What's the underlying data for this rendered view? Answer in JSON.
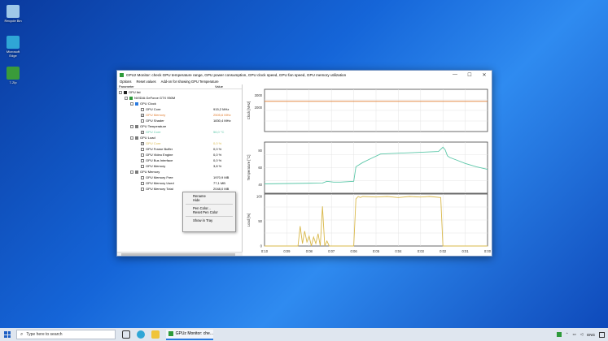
{
  "desktop": {
    "icons": [
      {
        "label": "Recycle Bin",
        "color": "#9ec8e8"
      },
      {
        "label": "Microsoft Edge",
        "color": "#2fa6d6"
      },
      {
        "label": "7-Zip",
        "color": "#3a9b3a"
      }
    ]
  },
  "window": {
    "title": "GPUz Monitor: check GPU temperature range, GPU power consumption, GPU clock speed, GPU fan speed, GPU memory utilization",
    "minimize": "—",
    "maximize": "☐",
    "close": "✕",
    "menu": [
      "Options",
      "Reset values",
      "Add-on for showing GPU Temperature"
    ]
  },
  "tree": {
    "col_parameter": "Parameter",
    "col_value": "Value",
    "rows": [
      {
        "label": "GPU list",
        "value": "",
        "level": 0,
        "exp": "-",
        "checked": false,
        "cb": false,
        "color": "#000",
        "icon": "#222"
      },
      {
        "label": "NVIDIA GeForce GTX 950M",
        "value": "",
        "level": 1,
        "exp": "-",
        "checked": false,
        "cb": false,
        "color": "#000",
        "icon": "#2e9a3a"
      },
      {
        "label": "GPU Clock",
        "value": "",
        "level": 2,
        "exp": "-",
        "checked": false,
        "cb": false,
        "color": "#000",
        "icon": "#2a7adf"
      },
      {
        "label": "GPU Core",
        "value": "915,2 MHz",
        "level": 3,
        "exp": "",
        "checked": false,
        "cb": true,
        "color": "#000",
        "icon": ""
      },
      {
        "label": "GPU Memory",
        "value": "2505,6 MHz",
        "level": 3,
        "exp": "",
        "checked": true,
        "cb": true,
        "color": "#e07b2e",
        "icon": ""
      },
      {
        "label": "GPU Shader",
        "value": "1830,4 MHz",
        "level": 3,
        "exp": "",
        "checked": false,
        "cb": true,
        "color": "#000",
        "icon": ""
      },
      {
        "label": "GPU Temperature",
        "value": "",
        "level": 2,
        "exp": "-",
        "checked": false,
        "cb": false,
        "color": "#000",
        "icon": "#7a7a7a"
      },
      {
        "label": "GPU Core",
        "value": "56,0 °C",
        "level": 3,
        "exp": "",
        "checked": true,
        "cb": true,
        "color": "#5bc7a8",
        "icon": ""
      },
      {
        "label": "GPU Load",
        "value": "",
        "level": 2,
        "exp": "-",
        "checked": false,
        "cb": false,
        "color": "#000",
        "icon": "#7a7a7a"
      },
      {
        "label": "GPU Core",
        "value": "0,0 %",
        "level": 3,
        "exp": "",
        "checked": true,
        "cb": true,
        "color": "#d9b84a",
        "icon": ""
      },
      {
        "label": "GPU Frame Buffer",
        "value": "0,0 %",
        "level": 3,
        "exp": "",
        "checked": false,
        "cb": true,
        "color": "#000",
        "icon": ""
      },
      {
        "label": "GPU Video Engine",
        "value": "0,0 %",
        "level": 3,
        "exp": "",
        "checked": false,
        "cb": true,
        "color": "#000",
        "icon": ""
      },
      {
        "label": "GPU Bus Interface",
        "value": "0,0 %",
        "level": 3,
        "exp": "",
        "checked": false,
        "cb": true,
        "color": "#000",
        "icon": ""
      },
      {
        "label": "GPU Memory",
        "value": "3,8 %",
        "level": 3,
        "exp": "",
        "checked": false,
        "cb": true,
        "color": "#000",
        "icon": ""
      },
      {
        "label": "GPU Memory",
        "value": "",
        "level": 2,
        "exp": "-",
        "checked": false,
        "cb": false,
        "color": "#000",
        "icon": "#7a7a7a"
      },
      {
        "label": "GPU Memory Free",
        "value": "1970,9 MB",
        "level": 3,
        "exp": "",
        "checked": false,
        "cb": true,
        "color": "#000",
        "icon": ""
      },
      {
        "label": "GPU Memory Used",
        "value": "77,1 MB",
        "level": 3,
        "exp": "",
        "checked": false,
        "cb": true,
        "color": "#000",
        "icon": ""
      },
      {
        "label": "GPU Memory Total",
        "value": "2048,0 MB",
        "level": 3,
        "exp": "",
        "checked": false,
        "cb": true,
        "color": "#000",
        "icon": ""
      }
    ]
  },
  "context_menu": {
    "group1": [
      "Rename",
      "Hide"
    ],
    "group2": [
      "Pen Color...",
      "Reset Pen Color"
    ],
    "group3": [
      "Show in Tray"
    ]
  },
  "chart_data": [
    {
      "type": "line",
      "ylabel": "Clock [MHz]",
      "ylim": [
        0,
        3500
      ],
      "yticks": [
        "3000",
        "2000"
      ],
      "series": [
        {
          "color": "#e07b2e",
          "x": [
            0,
            1
          ],
          "y": [
            2505.6,
            2505.6
          ]
        }
      ]
    },
    {
      "type": "line",
      "ylabel": "Temperature [°C]",
      "ylim": [
        30,
        90
      ],
      "yticks": [
        "80",
        "60",
        "40"
      ],
      "series": [
        {
          "color": "#5bc7a8",
          "x": [
            0,
            0.26,
            0.28,
            0.31,
            0.34,
            0.4,
            0.41,
            0.44,
            0.48,
            0.52,
            0.6,
            0.7,
            0.78,
            0.8,
            0.81,
            0.82,
            0.83,
            0.86,
            0.9,
            0.95,
            1
          ],
          "y": [
            41,
            42,
            44,
            43,
            43,
            44,
            61,
            66,
            71,
            76,
            77,
            78,
            79,
            84,
            81,
            74,
            72,
            69,
            65,
            61,
            58
          ]
        }
      ]
    },
    {
      "type": "line",
      "ylabel": "Load [%]",
      "ylim": [
        0,
        105
      ],
      "yticks": [
        "100",
        "50",
        "0"
      ],
      "xticks": [
        "0:10",
        "0:09",
        "0:08",
        "0:07",
        "0:06",
        "0:05",
        "0:04",
        "0:03",
        "0:02",
        "0:01",
        "0:00"
      ],
      "series": [
        {
          "color": "#d9b84a",
          "x": [
            0,
            0.15,
            0.16,
            0.17,
            0.18,
            0.19,
            0.2,
            0.21,
            0.22,
            0.23,
            0.24,
            0.25,
            0.26,
            0.27,
            0.28,
            0.29,
            0.3,
            0.31,
            0.4,
            0.41,
            0.42,
            0.43,
            0.44,
            0.5,
            0.55,
            0.6,
            0.65,
            0.7,
            0.74,
            0.79,
            0.8,
            0.81,
            0.85,
            0.9,
            1
          ],
          "y": [
            0,
            0,
            40,
            5,
            30,
            8,
            20,
            0,
            18,
            5,
            25,
            0,
            80,
            0,
            10,
            0,
            0,
            0,
            0,
            95,
            100,
            98,
            100,
            99,
            100,
            98,
            100,
            99,
            100,
            98,
            0,
            0,
            0,
            0,
            0
          ]
        }
      ]
    }
  ],
  "taskbar": {
    "search_placeholder": "Type here to search",
    "app_label": "GPUz Monitor: che...",
    "lang": "ENG"
  }
}
